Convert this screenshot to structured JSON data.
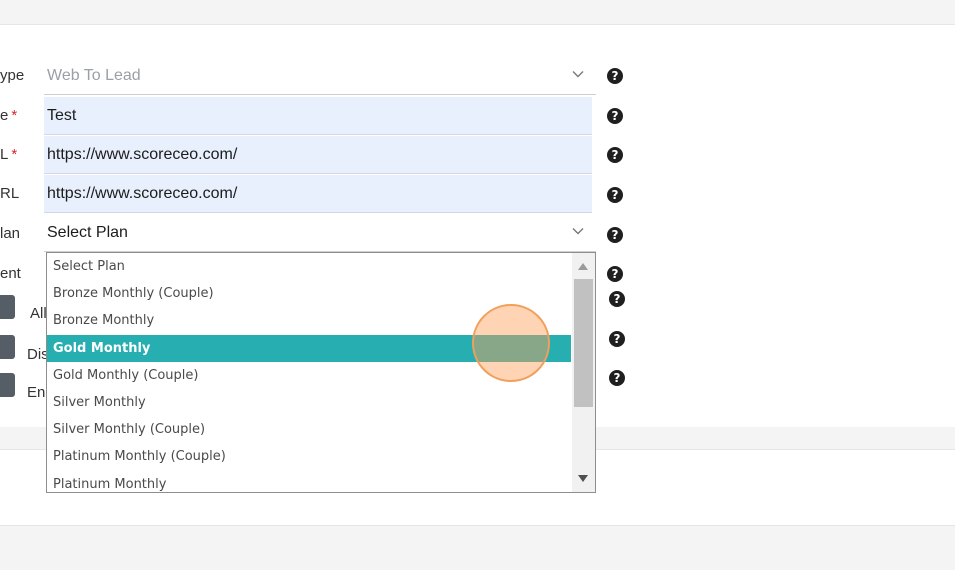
{
  "form": {
    "type_label": "ype",
    "type_value": "Web To Lead",
    "name_label": "e",
    "name_value": "Test",
    "url_label": "L",
    "url_value": "https://www.scoreceo.com/",
    "url2_label": "RL",
    "url2_value": "https://www.scoreceo.com/",
    "plan_label": "lan",
    "plan_value": "Select Plan",
    "ent_label": "ent",
    "required_mark": "*",
    "help_glyph": "?",
    "checks": [
      {
        "label": "All"
      },
      {
        "label": "Dis"
      },
      {
        "label": "En"
      }
    ]
  },
  "dropdown": {
    "options": [
      "Select Plan",
      "Bronze Monthly (Couple)",
      "Bronze Monthly",
      "Gold Monthly",
      "Gold Monthly (Couple)",
      "Silver Monthly",
      "Silver Monthly (Couple)",
      "Platinum Monthly (Couple)",
      "Platinum Monthly"
    ],
    "highlighted": "Gold Monthly"
  },
  "icons": {
    "help": "question-circle-icon",
    "chevron": "chevron-down-icon"
  },
  "colors": {
    "highlight": "#27aeb0",
    "filled_field": "#e8effd",
    "required": "#d9232d"
  }
}
